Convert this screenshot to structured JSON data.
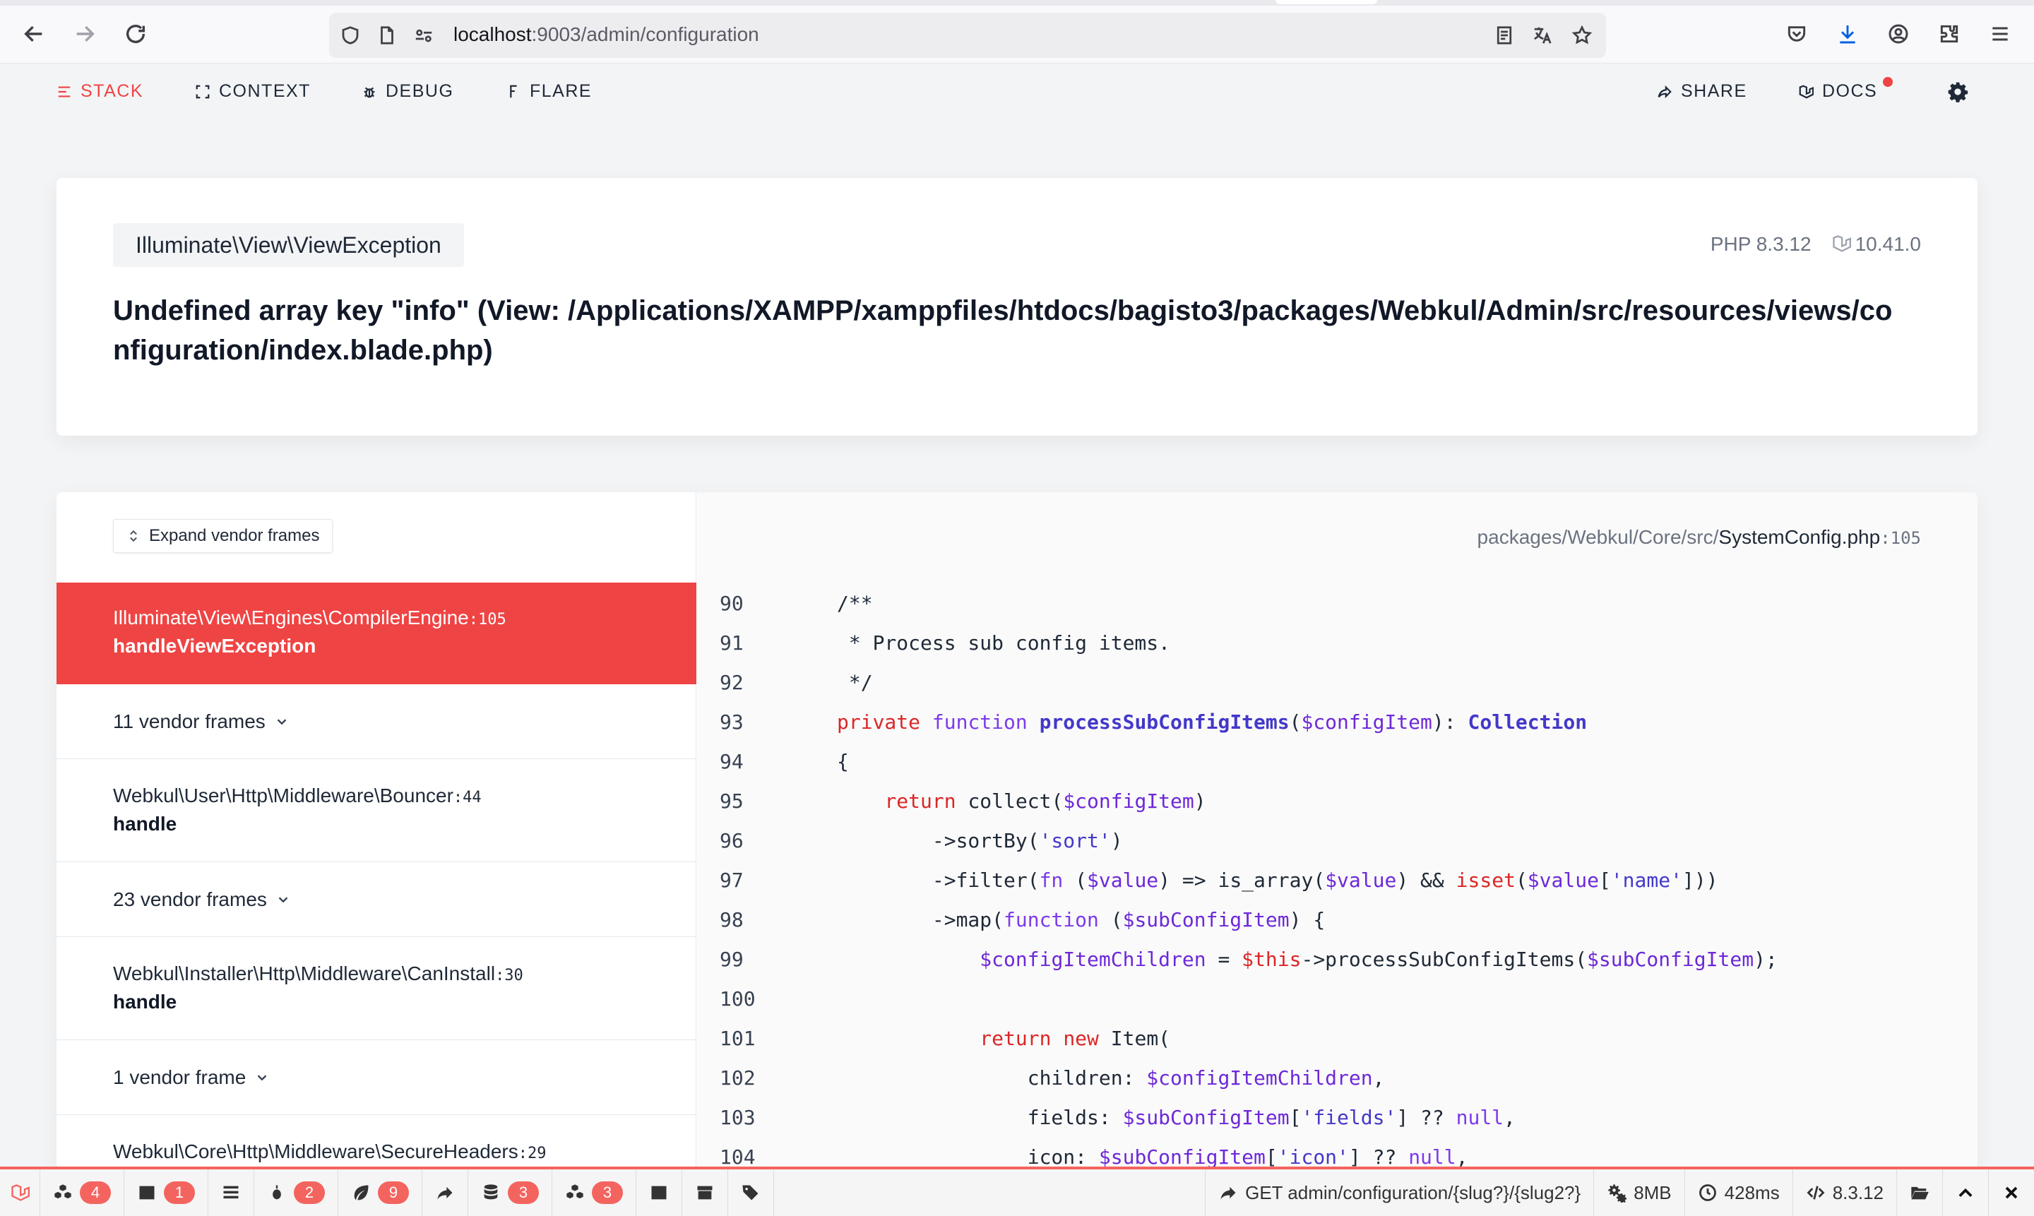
{
  "browser": {
    "url_host": "localhost",
    "url_path": ":9003/admin/configuration"
  },
  "nav": {
    "stack": "STACK",
    "context": "CONTEXT",
    "debug": "DEBUG",
    "flare": "FLARE",
    "share": "SHARE",
    "docs": "DOCS"
  },
  "exception": {
    "class": "Illuminate\\View\\ViewException",
    "php_version": "PHP 8.3.12",
    "laravel_version": "10.41.0",
    "message": "Undefined array key \"info\" (View: /Applications/XAMPP/xamppfiles/htdocs/bagisto3/packages/Webkul/Admin/src/resources/views/configuration/index.blade.php)"
  },
  "frames": {
    "expand_label": "Expand vendor frames",
    "items": [
      {
        "class": "Illuminate\\View\\Engines\\CompilerEngine",
        "line": ":105",
        "function": "handleViewException"
      },
      {
        "class": "Webkul\\User\\Http\\Middleware\\Bouncer",
        "line": ":44",
        "function": "handle"
      },
      {
        "class": "Webkul\\Installer\\Http\\Middleware\\CanInstall",
        "line": ":30",
        "function": "handle"
      },
      {
        "class": "Webkul\\Core\\Http\\Middleware\\SecureHeaders",
        "line": ":29",
        "function": ""
      }
    ],
    "vendor_groups": [
      "11 vendor frames",
      "23 vendor frames",
      "1 vendor frame"
    ]
  },
  "code": {
    "file_dir": "packages/Webkul/Core/src/",
    "file_name": "SystemConfig.php",
    "file_line": ":105",
    "line_numbers": [
      "90",
      "91",
      "92",
      "93",
      "94",
      "95",
      "96",
      "97",
      "98",
      "99",
      "100",
      "101",
      "102",
      "103",
      "104"
    ]
  },
  "debugbar": {
    "badges": [
      "4",
      "1",
      "2",
      "9",
      "3",
      "3"
    ],
    "route": "GET admin/configuration/{slug?}/{slug2?}",
    "memory": "8MB",
    "time": "428ms",
    "php": "8.3.12"
  },
  "colors": {
    "accent": "#ef4444",
    "debugbar_accent": "#f4645f"
  }
}
